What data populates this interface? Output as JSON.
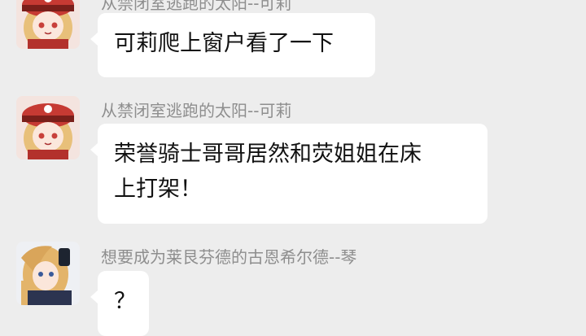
{
  "messages": [
    {
      "sender": "从禁闭室逃跑的太阳--可莉",
      "text": "可莉爬上窗户看了一下",
      "avatar": "klee-avatar"
    },
    {
      "sender": "从禁闭室逃跑的太阳--可莉",
      "text_line1": "荣誉骑士哥哥居然和荧姐姐在床",
      "text_line2": "上打架！",
      "avatar": "klee-avatar"
    },
    {
      "sender": "想要成为莱艮芬德的古恩希尔德--琴",
      "text": "？",
      "avatar": "jean-avatar"
    }
  ],
  "colors": {
    "background": "#ededed",
    "bubble": "#ffffff",
    "sender_name": "#8e8e8e",
    "klee_hat": "#c63a33",
    "hair_blonde": "#e8c07a"
  }
}
